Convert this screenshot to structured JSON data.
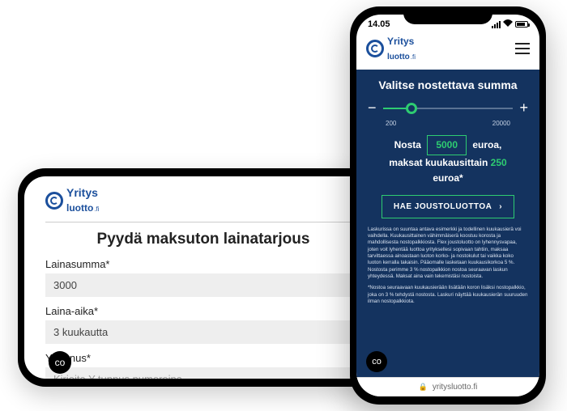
{
  "brand": {
    "line1": "Yritys",
    "line2": "luotto",
    "suffix": ".fi"
  },
  "landscape": {
    "heading": "Pyydä maksuton lainatarjous",
    "fields": {
      "amount": {
        "label": "Lainasumma*",
        "value": "3000"
      },
      "term": {
        "label": "Laina-aika*",
        "value": "3 kuukautta"
      },
      "ytunnus": {
        "label": "Y-tunnus*",
        "placeholder": "Kirjoita Y-tunnus numeroina"
      }
    }
  },
  "portrait": {
    "statusbar": {
      "time": "14.05"
    },
    "panel": {
      "heading": "Valitse nostettava summa",
      "slider": {
        "min_label": "200",
        "max_label": "20000"
      },
      "summary": {
        "prefix": "Nosta",
        "amount": "5000",
        "after_amount": "euroa,",
        "line2a": "maksat kuukausittain",
        "monthly": "250",
        "line2b": "euroa*"
      },
      "cta": "HAE JOUSTOLUOTTOA",
      "fineprint1": "Laskurissa on suuntaa antava esimerkki ja todellinen kuukausierä voi vaihdella. Kuukausittainen vähimmäiserä koostuu korosta ja mahdollisesta nostopalkkiosta. Flex joustoluotto on lyhennysvapaa, joten voit lyhentää luottoa yrityksellesi sopivaan tahtiin, maksaa tarvittaessa ainoastaan luoton korko- ja nostokulut tai vaikka koko luoton kerralla takaisin. Pääomalle lasketaan kuukausikorkoa 5 %. Nostosta perimme 3 % nostopalkkion nostoa seuraavan laskun yhteydessä. Maksat aina vain tekemistäsi nostoista.",
      "fineprint2": "*Nostoa seuraavaan kuukausierään lisätään koron lisäksi nostopalkkio, joka on 3 % tehdystä nostosta. Laskuri näyttää kuukausierän suuruuden ilman nostopalkkiota."
    },
    "url": "yritysluotto.fi"
  },
  "icons": {
    "minus": "−",
    "plus": "+",
    "chevron": "›",
    "lock": "🔒",
    "badge": "c⁠o"
  }
}
